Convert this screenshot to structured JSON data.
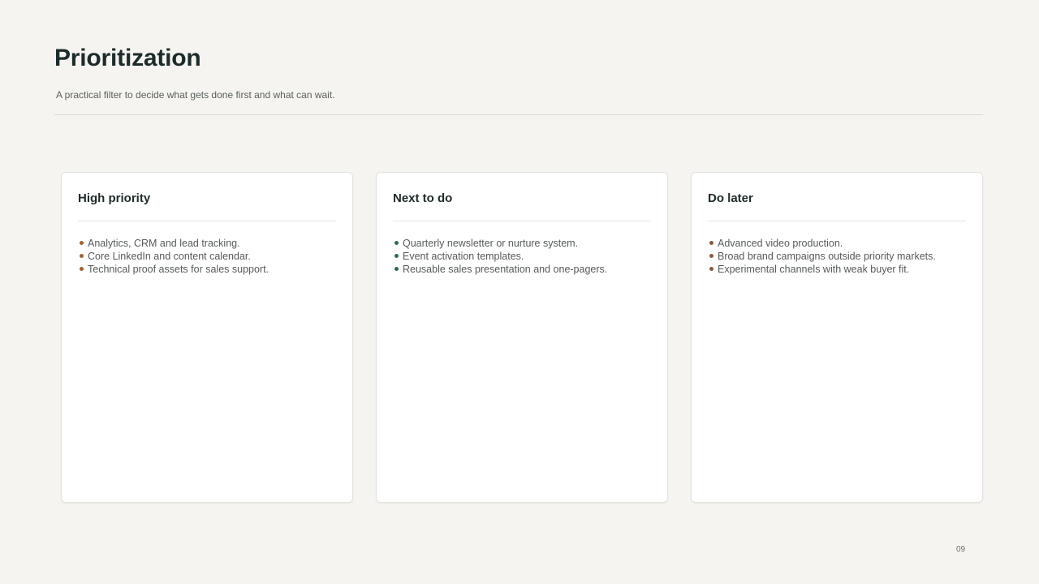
{
  "slide": {
    "title": "Prioritization",
    "subtitle": "A practical filter to decide what gets done first and what can wait.",
    "page_number": "09"
  },
  "colors": {
    "background": "#f5f4f0",
    "accent_copper": "#a0623b",
    "accent_green": "#2e6b4c"
  },
  "cards": [
    {
      "title": "High priority",
      "bullet_color": "#a0623b",
      "items": [
        "Analytics, CRM and lead tracking.",
        "Core LinkedIn and content calendar.",
        "Technical proof assets for sales support."
      ]
    },
    {
      "title": "Next to do",
      "bullet_color": "#2e6b4c",
      "items": [
        "Quarterly newsletter or nurture system.",
        "Event activation templates.",
        "Reusable sales presentation and one-pagers."
      ]
    },
    {
      "title": "Do later",
      "bullet_color": "#8a5a3c",
      "items": [
        "Advanced video production.",
        "Broad brand campaigns outside priority markets.",
        "Experimental channels with weak buyer fit."
      ]
    }
  ]
}
